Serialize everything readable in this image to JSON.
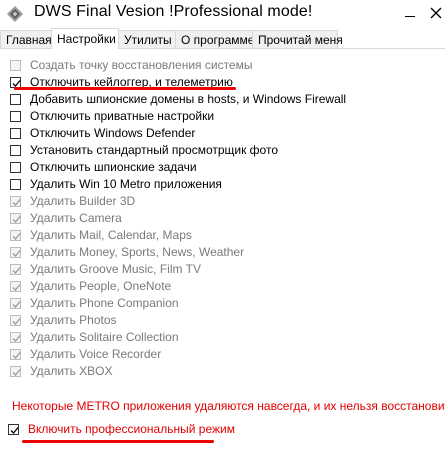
{
  "window": {
    "title": "DWS Final Vesion  !Professional mode!",
    "minimize_symbol": "—",
    "close_symbol": "✕"
  },
  "tabs": [
    {
      "label": "Главная",
      "active": false
    },
    {
      "label": "Настройки",
      "active": true
    },
    {
      "label": "Утилиты",
      "active": false
    },
    {
      "label": "О программе",
      "active": false
    },
    {
      "label": "Прочитай меня",
      "active": false
    }
  ],
  "options": [
    {
      "label": "Создать точку восстановления системы",
      "checked": false,
      "disabled": true
    },
    {
      "label": "Отключить кейлоггер, и телеметрию",
      "checked": true,
      "disabled": false
    },
    {
      "label": "Добавить шпионские домены в hosts, и Windows Firewall",
      "checked": false,
      "disabled": false
    },
    {
      "label": "Отключить приватные настройки",
      "checked": false,
      "disabled": false
    },
    {
      "label": "Отключить Windows Defender",
      "checked": false,
      "disabled": false
    },
    {
      "label": "Установить стандартный просмотрщик фото",
      "checked": false,
      "disabled": false
    },
    {
      "label": "Отключить шпионские задачи",
      "checked": false,
      "disabled": false
    },
    {
      "label": "Удалить Win 10 Metro приложения",
      "checked": false,
      "disabled": false
    },
    {
      "label": "Удалить Builder 3D",
      "checked": true,
      "disabled": true
    },
    {
      "label": "Удалить Camera",
      "checked": true,
      "disabled": true
    },
    {
      "label": "Удалить Mail, Calendar, Maps",
      "checked": true,
      "disabled": true
    },
    {
      "label": "Удалить Money, Sports, News, Weather",
      "checked": true,
      "disabled": true
    },
    {
      "label": "Удалить Groove Music, Film TV",
      "checked": true,
      "disabled": true
    },
    {
      "label": "Удалить People, OneNote",
      "checked": true,
      "disabled": true
    },
    {
      "label": "Удалить Phone Companion",
      "checked": true,
      "disabled": true
    },
    {
      "label": "Удалить Photos",
      "checked": true,
      "disabled": true
    },
    {
      "label": "Удалить Solitaire Collection",
      "checked": true,
      "disabled": true
    },
    {
      "label": "Удалить Voice Recorder",
      "checked": true,
      "disabled": true
    },
    {
      "label": "Удалить XBOX",
      "checked": true,
      "disabled": true
    }
  ],
  "warning_text": "Некоторые METRO приложения удаляются навсегда, и их нельзя восстановить",
  "pro_mode": {
    "label": "Включить профессиональный режим",
    "checked": true
  },
  "colors": {
    "warning": "#e00000",
    "underline": "#ee0000"
  }
}
